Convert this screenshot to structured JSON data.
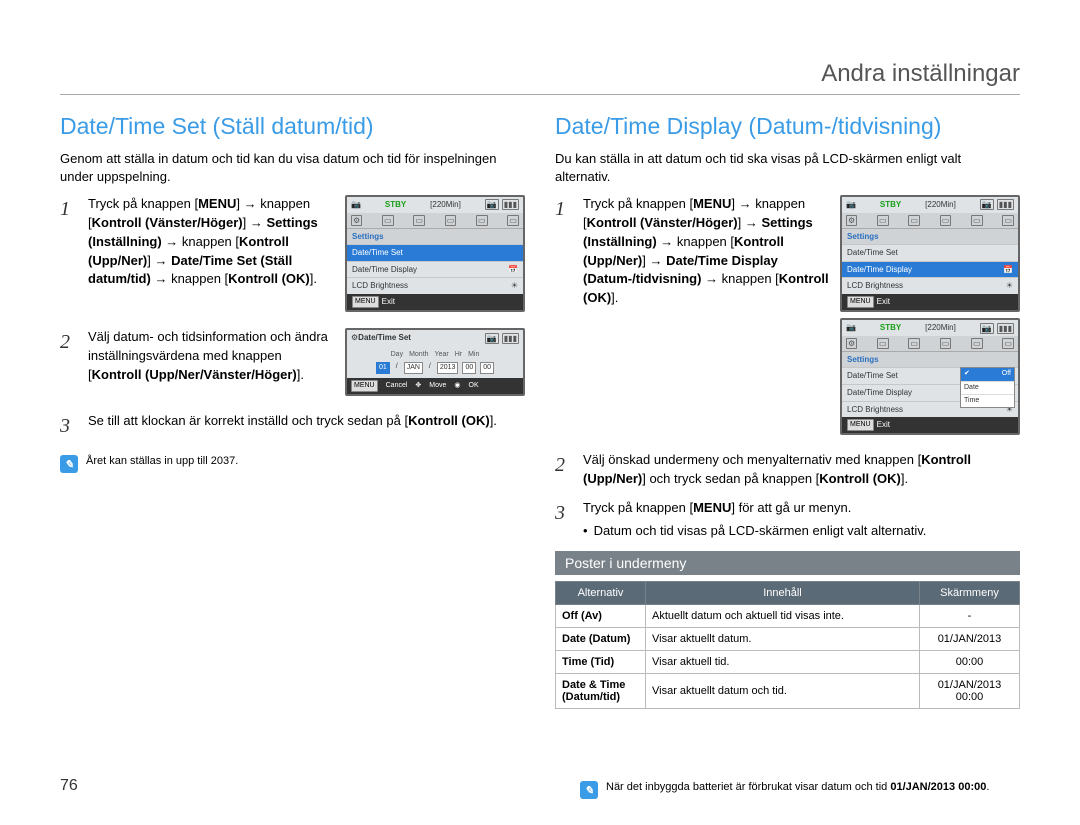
{
  "page_header": "Andra inställningar",
  "page_number": "76",
  "left": {
    "heading": "Date/Time Set (Ställ datum/tid)",
    "intro": "Genom att ställa in datum och tid kan du visa datum och tid för inspelningen under uppspelning.",
    "steps": {
      "s1": {
        "num": "1",
        "p1": "Tryck på knappen [",
        "menu": "MENU",
        "p2": "] ",
        "arr": "→",
        "p3": " knappen [",
        "kv": "Kontroll (Vänster/Höger)",
        "p4": "] ",
        "p5": " ",
        "set": "Settings (Inställning)",
        "p6": " knappen [",
        "kun": "Kontroll (Upp/Ner)",
        "p7": "] ",
        "dts": "Date/Time Set (Ställ datum/tid)",
        "p8": " knappen [",
        "kok": "Kontroll (OK)",
        "p9": "]."
      },
      "s2": {
        "num": "2",
        "t1": "Välj datum- och tidsinformation och ändra inställningsvärdena med knappen [",
        "b1": "Kontroll (Upp/Ner/Vänster/Höger)",
        "t2": "]."
      },
      "s3": {
        "num": "3",
        "t1": "Se till att klockan är korrekt inställd och tryck sedan på [",
        "b1": "Kontroll (OK)",
        "t2": "]."
      }
    },
    "note": "Året kan ställas in upp till 2037.",
    "lcd1": {
      "stby": "STBY",
      "time": "220Min",
      "tab": "Settings",
      "row1": "Date/Time Set",
      "row2": "Date/Time Display",
      "row3": "LCD Brightness",
      "exit": "Exit",
      "menu": "MENU"
    },
    "lcd2": {
      "title": "Date/Time Set",
      "h_day": "Day",
      "h_mon": "Month",
      "h_yr": "Year",
      "h_hr": "Hr",
      "h_min": "Min",
      "v_day": "01",
      "v_mon": "JAN",
      "v_yr": "2013",
      "v_hr": "00",
      "v_min": "00",
      "sep": "/",
      "cancel": "Cancel",
      "move": "Move",
      "ok": "OK",
      "menu": "MENU"
    }
  },
  "right": {
    "heading": "Date/Time Display (Datum-/tidvisning)",
    "intro": "Du kan ställa in att datum och tid ska visas på LCD-skärmen enligt valt alternativ.",
    "steps": {
      "s1": {
        "num": "1",
        "p1": "Tryck på knappen [",
        "menu": "MENU",
        "p2": "] ",
        "arr": "→",
        "p3": " knappen [",
        "kv": "Kontroll (Vänster/Höger)",
        "p4": "] ",
        "set": "Settings (Inställning)",
        "p5": " knappen [",
        "kun": "Kontroll (Upp/Ner)",
        "p6": "] ",
        "dtd": "Date/Time Display (Datum-/tidvisning)",
        "p7": " knappen [",
        "kok": "Kontroll (OK)",
        "p8": "]."
      },
      "s2": {
        "num": "2",
        "t1": "Välj önskad undermeny och menyalternativ med knappen [",
        "b1": "Kontroll (Upp/Ner)",
        "t2": "] och tryck sedan på knappen [",
        "b2": "Kontroll (OK)",
        "t3": "]."
      },
      "s3": {
        "num": "3",
        "t1": "Tryck på knappen [",
        "b1": "MENU",
        "t2": "] för att gå ur menyn.",
        "bullet": "Datum och tid visas på LCD-skärmen enligt valt alternativ."
      }
    },
    "lcd1": {
      "stby": "STBY",
      "time": "220Min",
      "tab": "Settings",
      "row1": "Date/Time Set",
      "row2": "Date/Time Display",
      "row3": "LCD Brightness",
      "exit": "Exit",
      "menu": "MENU"
    },
    "lcd2": {
      "stby": "STBY",
      "time": "220Min",
      "tab": "Settings",
      "row1": "Date/Time Set",
      "row2": "Date/Time Display",
      "row3": "LCD Brightness",
      "exit": "Exit",
      "menu": "MENU",
      "opt_off": "Off",
      "opt_date": "Date",
      "opt_time": "Time",
      "check": "✔"
    },
    "subhead": "Poster i undermeny",
    "table": {
      "h1": "Alternativ",
      "h2": "Innehåll",
      "h3": "Skärmmeny",
      "r1o": "Off (Av)",
      "r1c": "Aktuellt datum och aktuell tid visas inte.",
      "r1m": "-",
      "r2o": "Date (Datum)",
      "r2c": "Visar aktuellt datum.",
      "r2m": "01/JAN/2013",
      "r3o": "Time (Tid)",
      "r3c": "Visar aktuell tid.",
      "r3m": "00:00",
      "r4o": "Date & Time (Datum/tid)",
      "r4c": "Visar aktuellt datum och tid.",
      "r4m1": "01/JAN/2013",
      "r4m2": "00:00"
    },
    "bottom_note": {
      "t1": "När det inbyggda batteriet är förbrukat visar datum och tid ",
      "b": "01/JAN/2013 00:00",
      "t2": "."
    }
  }
}
